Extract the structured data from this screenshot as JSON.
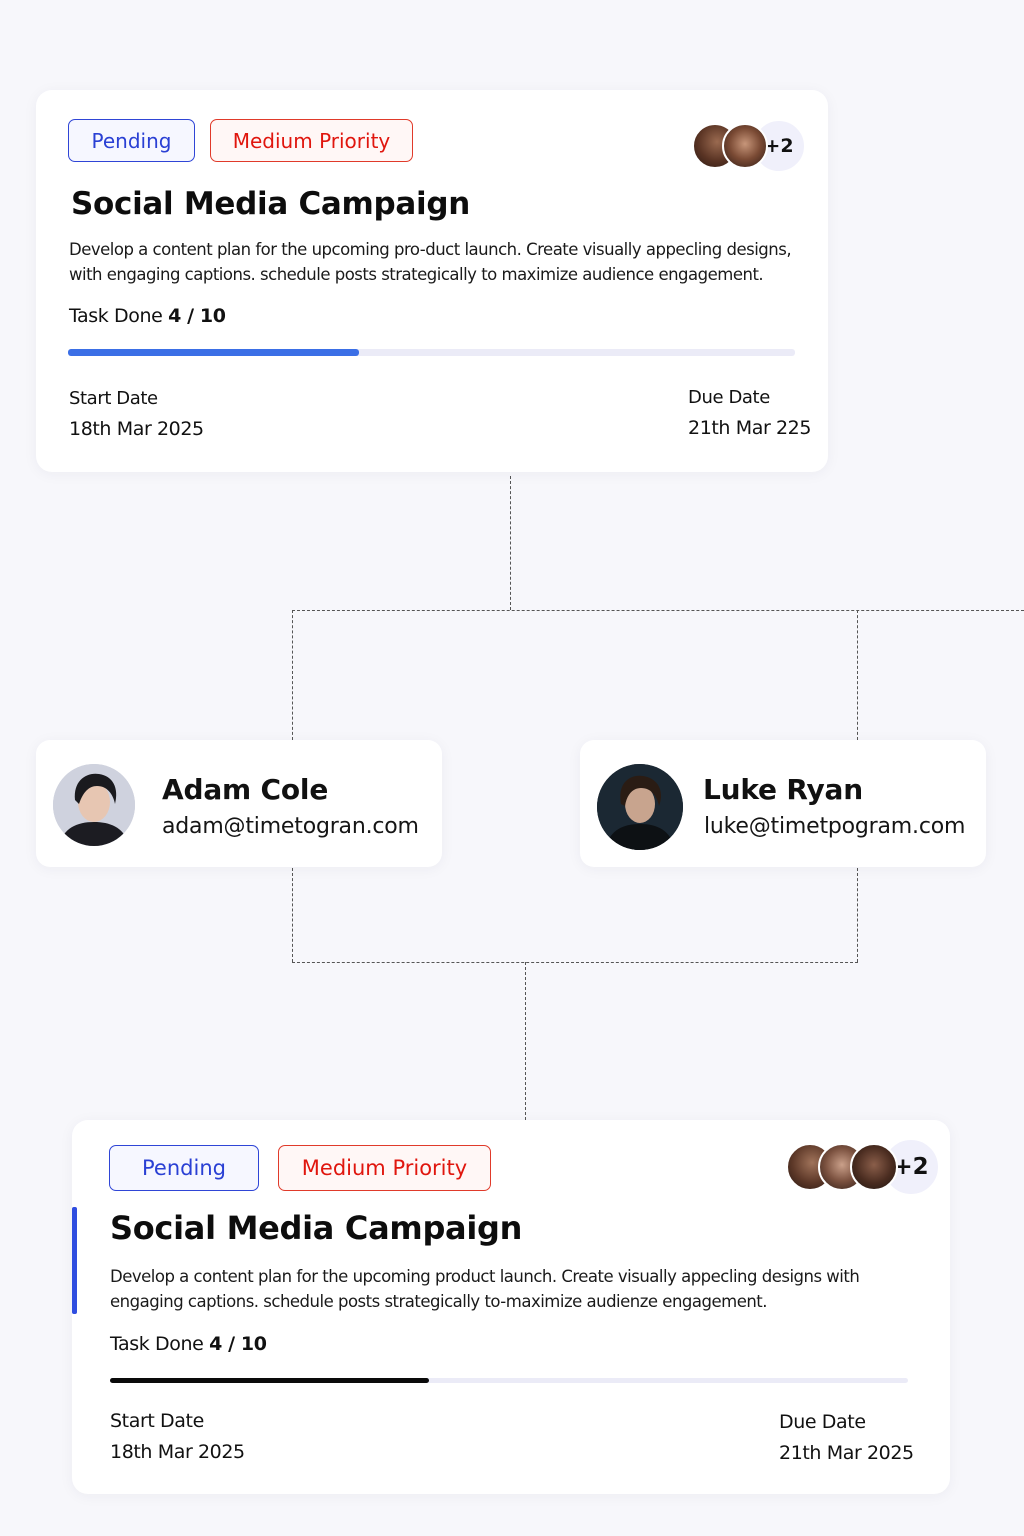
{
  "top_card": {
    "status": "Pending",
    "priority": "Medium Priority",
    "assignees_more": "+2",
    "title": "Social Media Campaign",
    "description": "Develop a content plan for the upcoming pro-duct launch. Create visually appecling designs, with engaging captions. schedule posts strategically to maximize audience engagement.",
    "task_label": "Task Done",
    "task_count": "4 / 10",
    "progress": 0.4,
    "start_label": "Start Date",
    "start_value": "18th Mar 2025",
    "due_label": "Due Date",
    "due_value": "21th Mar 225"
  },
  "members": [
    {
      "name": "Adam Cole",
      "email": "adam@timetogran.com"
    },
    {
      "name": "Luke Ryan",
      "email": "luke@timetpogram.com"
    }
  ],
  "bottom_card": {
    "status": "Pending",
    "priority": "Medium Priority",
    "assignees_more": "+2",
    "title": "Social Media Campaign",
    "description": "Develop a content plan for the upcoming product launch. Create visually appecling designs with engaging captions. schedule posts strategically to-maximize audienze engagement.",
    "task_label": "Task Done",
    "task_count": "4 / 10",
    "progress": 0.4,
    "start_label": "Start Date",
    "start_value": "18th Mar 2025",
    "due_label": "Due Date",
    "due_value": "21th Mar 2025"
  },
  "colors": {
    "pending": "#2a40d4",
    "priority": "#e0160e",
    "progress_top": "#3b6fe6",
    "progress_bottom": "#0a0a0a",
    "accent_bar": "#2f4de0"
  },
  "icons": {
    "avatar": "person-avatar-icon"
  }
}
